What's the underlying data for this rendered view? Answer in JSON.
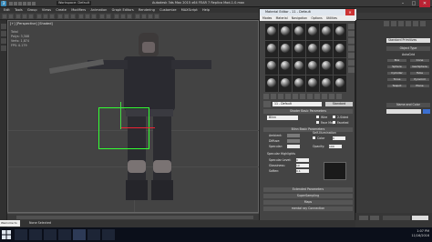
{
  "app": {
    "title": "Autodesk 3ds Max 2015 x64    FEAR 7 Replica Mod-1.0.max",
    "workspace": "Workspace: Default",
    "logo": "3",
    "window_controls": [
      "–",
      "□",
      "✕"
    ]
  },
  "menubar": [
    "Edit",
    "Tools",
    "Group",
    "Views",
    "Create",
    "Modifiers",
    "Animation",
    "Graph Editors",
    "Rendering",
    "Customize",
    "MAXScript",
    "Help"
  ],
  "viewport": {
    "label": "[+] [Perspective] [Shaded]",
    "stats": [
      "Total",
      "Polys:  3,308",
      "Verts:  1,874",
      "",
      "FPS:    0.179"
    ]
  },
  "material_editor": {
    "title": "Material Editor - 11 - Default",
    "menu": [
      "Modes",
      "Material",
      "Navigation",
      "Options",
      "Utilities"
    ],
    "name": "11 - Default",
    "type": "Standard",
    "rollouts": {
      "shader_basic": "Shader Basic Parameters",
      "blinn_basic": "Blinn Basic Parameters",
      "extended": "Extended Parameters",
      "supersampling": "SuperSampling",
      "maps": "Maps",
      "mental_ray": "mental ray Connection"
    },
    "shader": "Blinn",
    "options": [
      "Wire",
      "2-Sided",
      "Face Map",
      "Faceted"
    ],
    "color_labels": [
      "Ambient:",
      "Diffuse:",
      "Specular:"
    ],
    "self_illum_label": "Self-Illumination",
    "color_check": "Color",
    "opacity_label": "Opacity:",
    "opacity_value": "100",
    "self_illum_value": "0",
    "specular_highlights": "Specular Highlights",
    "spec_labels": [
      "Specular Level:",
      "Glossiness:",
      "Soften:"
    ],
    "spec_values": [
      "0",
      "10",
      "0.1"
    ]
  },
  "command_panel": {
    "dropdown": "Standard Primitives",
    "object_type": "Object Type",
    "autogrid": "AutoGrid",
    "buttons": [
      "Box",
      "Cone",
      "Sphere",
      "GeoSphere",
      "Cylinder",
      "Tube",
      "Torus",
      "Pyramid",
      "Teapot",
      "Plane"
    ],
    "name_and_color": "Name and Color"
  },
  "status": {
    "text": "None Selected",
    "maxscript": "Welcome to M",
    "date": "11/16/2016",
    "time": "1:07 PM"
  },
  "colors": {
    "bbox": "#33ff33",
    "material_swatch": "#1a1a1a",
    "object_color": "#3b6fd0"
  }
}
